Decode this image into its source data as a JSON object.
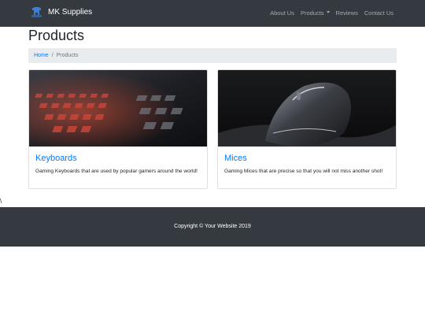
{
  "navbar": {
    "brand": "MK Supplies",
    "links": [
      "About Us",
      "Products",
      "Reviews",
      "Contact Us"
    ]
  },
  "page": {
    "title": "Products"
  },
  "breadcrumb": {
    "home": "Home",
    "current": "Products"
  },
  "cards": [
    {
      "title": "Keyboards",
      "text": "Gaming Keyboards that are used by popular gamers around the world!"
    },
    {
      "title": "Mices",
      "text": "Gaming Mices that are precise so that you will not miss another shot!"
    }
  ],
  "stray_text": "\\",
  "footer": {
    "copyright": "Copyright © Your Website 2019"
  },
  "colors": {
    "navbar": "#343a40",
    "link": "#007bff",
    "breadcrumb_bg": "#e9ecef",
    "footer": "#343a40"
  }
}
